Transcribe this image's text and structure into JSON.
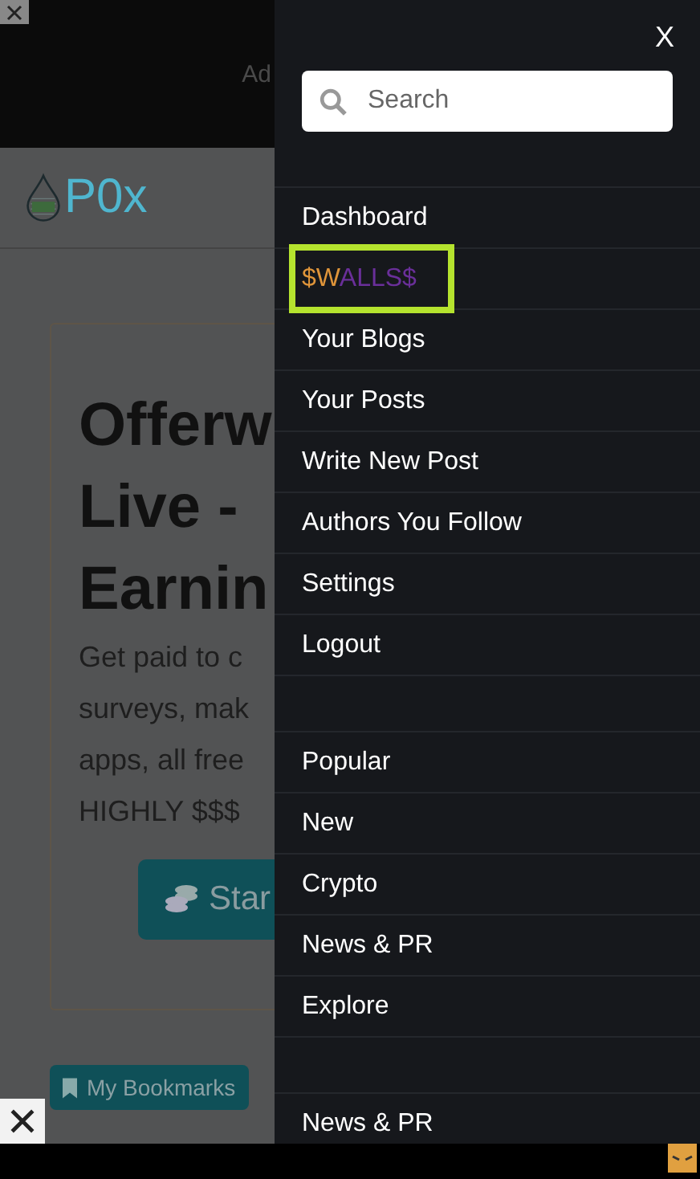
{
  "ad_banner": {
    "label": "Ad"
  },
  "site_header": {
    "logo_text": "P0x"
  },
  "card": {
    "title_lines": [
      "Offerw",
      "Live -",
      "Earnin"
    ],
    "body_lines": [
      "Get paid to c",
      "surveys, mak",
      "apps, all free",
      "HIGHLY $$$"
    ],
    "button": "Star"
  },
  "bottom_buttons": [
    "My Bookmarks"
  ],
  "drawer": {
    "close": "X",
    "search": {
      "placeholder": "Search"
    },
    "groups": [
      {
        "items": [
          {
            "label": "Dashboard",
            "highlighted": false
          },
          {
            "parts": [
              {
                "text": "$W",
                "color": "#e0953a"
              },
              {
                "text": "ALLS$",
                "color": "#6a2f9a"
              }
            ],
            "highlighted": true
          },
          {
            "label": "Your Blogs",
            "highlighted": false
          },
          {
            "label": "Your Posts",
            "highlighted": false
          },
          {
            "label": "Write New Post",
            "highlighted": false
          },
          {
            "label": "Authors You Follow",
            "highlighted": false
          },
          {
            "label": "Settings",
            "highlighted": false
          },
          {
            "label": "Logout",
            "highlighted": false
          }
        ]
      },
      {
        "items": [
          {
            "label": "Popular",
            "highlighted": false
          },
          {
            "label": "New",
            "highlighted": false
          },
          {
            "label": "Crypto",
            "highlighted": false
          },
          {
            "label": "News & PR",
            "highlighted": false
          },
          {
            "label": "Explore",
            "highlighted": false
          }
        ]
      },
      {
        "items": [
          {
            "label": "News & PR",
            "highlighted": false
          }
        ]
      }
    ]
  }
}
